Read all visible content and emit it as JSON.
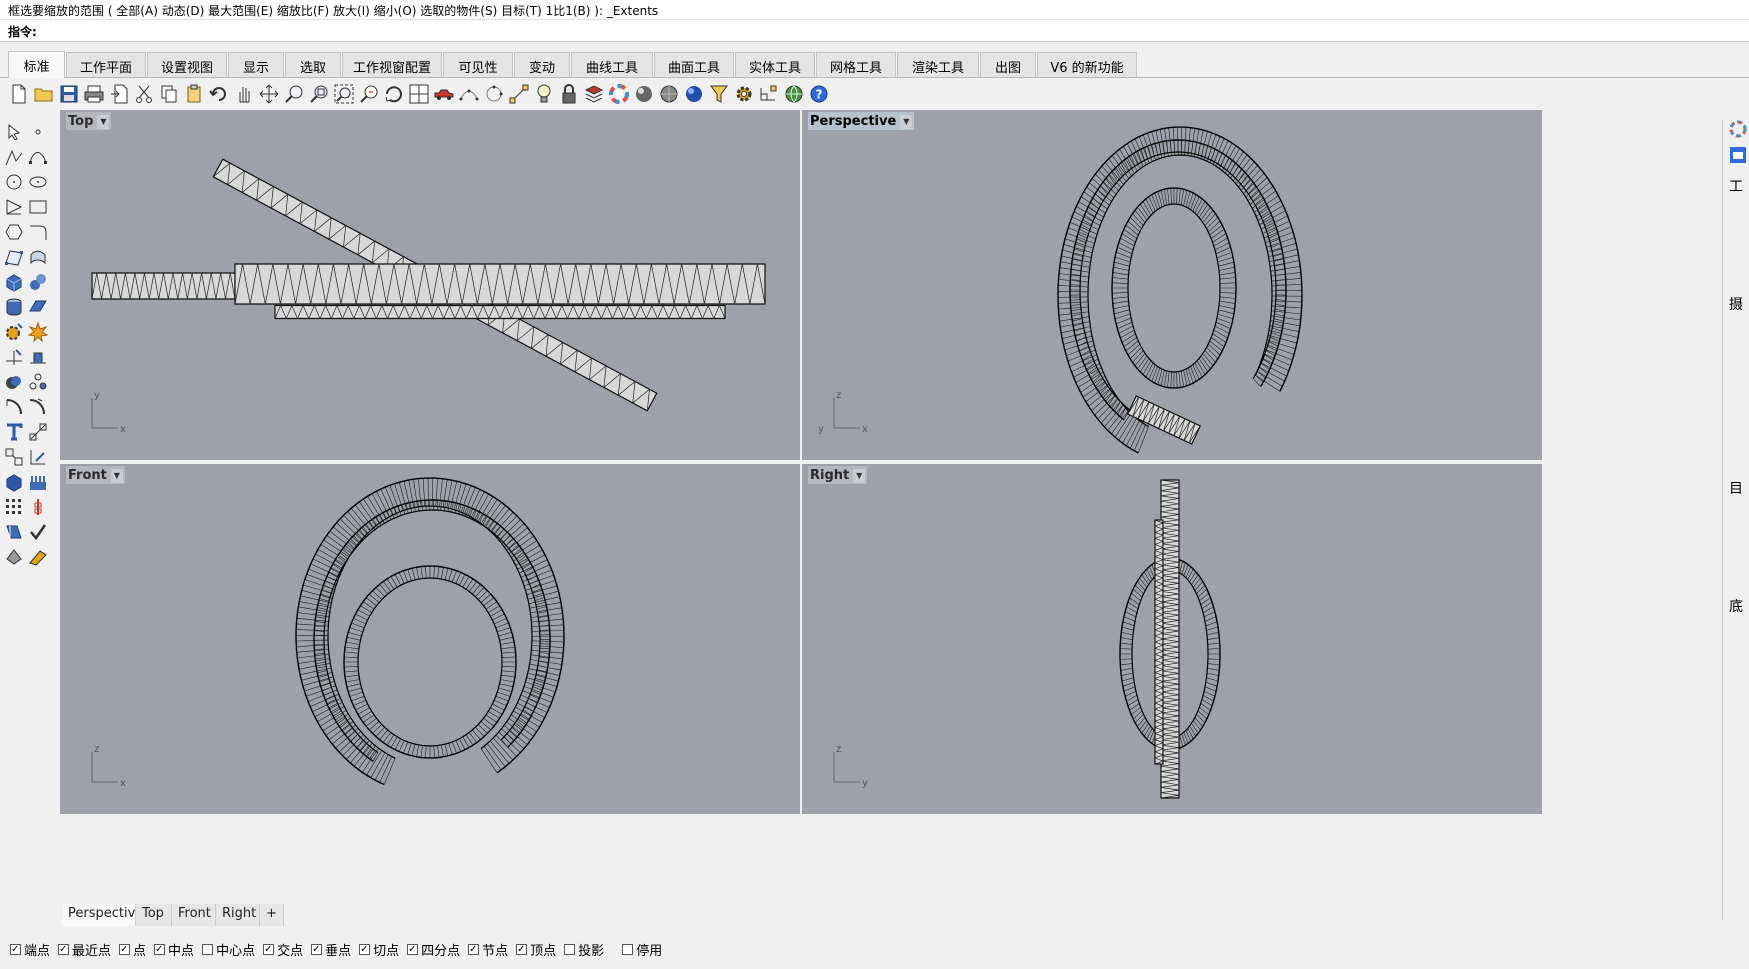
{
  "command": {
    "history": "框选要缩放的范围 ( 全部(A)  动态(D)  最大范围(E)  缩放比(F)  放大(I)  缩小(O)  选取的物件(S)  目标(T)  1比1(B) ): _Extents",
    "prompt": "指令:"
  },
  "tabs": [
    {
      "label": "标准",
      "active": true
    },
    {
      "label": "工作平面"
    },
    {
      "label": "设置视图"
    },
    {
      "label": "显示"
    },
    {
      "label": "选取"
    },
    {
      "label": "工作视窗配置"
    },
    {
      "label": "可见性"
    },
    {
      "label": "变动"
    },
    {
      "label": "曲线工具"
    },
    {
      "label": "曲面工具"
    },
    {
      "label": "实体工具"
    },
    {
      "label": "网格工具"
    },
    {
      "label": "渲染工具"
    },
    {
      "label": "出图"
    },
    {
      "label": "V6 的新功能"
    }
  ],
  "viewports": {
    "top": {
      "title": "Top",
      "axes": [
        "y",
        "x"
      ]
    },
    "perspective": {
      "title": "Perspective",
      "axes": [
        "z",
        "x",
        "y"
      ]
    },
    "front": {
      "title": "Front",
      "axes": [
        "z",
        "x"
      ]
    },
    "right": {
      "title": "Right",
      "axes": [
        "z",
        "y"
      ]
    }
  },
  "viewport_tabs": [
    {
      "label": "Perspective",
      "active": true
    },
    {
      "label": "Top"
    },
    {
      "label": "Front"
    },
    {
      "label": "Right"
    },
    {
      "label": "+"
    }
  ],
  "osnaps": [
    {
      "label": "端点",
      "checked": true
    },
    {
      "label": "最近点",
      "checked": true
    },
    {
      "label": "点",
      "checked": true
    },
    {
      "label": "中点",
      "checked": true
    },
    {
      "label": "中心点",
      "checked": false
    },
    {
      "label": "交点",
      "checked": true
    },
    {
      "label": "垂点",
      "checked": true
    },
    {
      "label": "切点",
      "checked": true
    },
    {
      "label": "四分点",
      "checked": true
    },
    {
      "label": "节点",
      "checked": true
    },
    {
      "label": "顶点",
      "checked": true
    },
    {
      "label": "投影",
      "checked": false
    },
    {
      "label": "停用",
      "checked": false
    }
  ],
  "right_panel": {
    "labels": [
      "工",
      "摄",
      "目",
      "底"
    ]
  },
  "colors": {
    "viewport_bg": "#9ea2a8",
    "active_title_bg": "#b7c2d0"
  }
}
